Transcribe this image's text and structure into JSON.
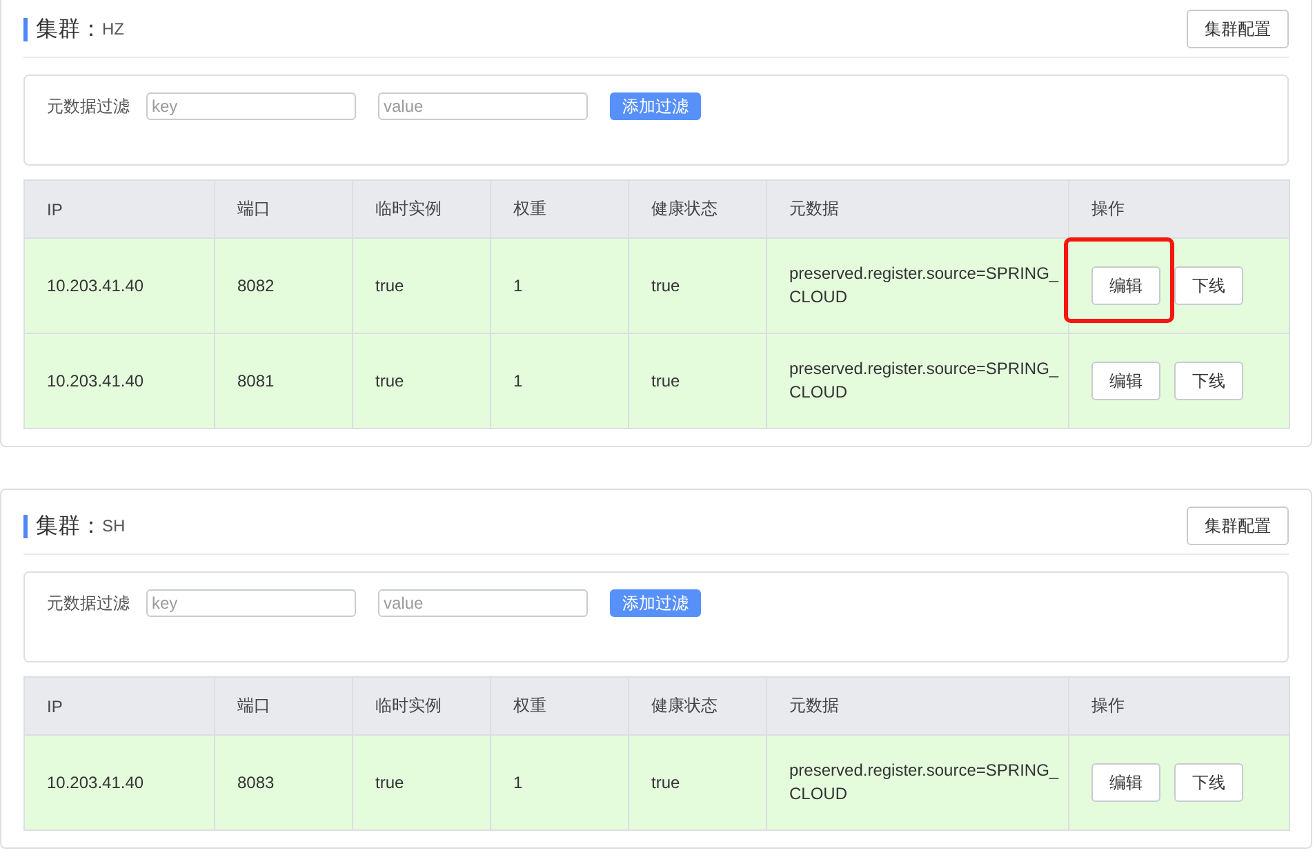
{
  "clusters": [
    {
      "cluster_label": "集群：",
      "name": "HZ",
      "config_button": "集群配置",
      "filter": {
        "label": "元数据过滤",
        "key_placeholder": "key",
        "value_placeholder": "value",
        "add_button": "添加过滤"
      },
      "columns": [
        "IP",
        "端口",
        "临时实例",
        "权重",
        "健康状态",
        "元数据",
        "操作"
      ],
      "rows": [
        {
          "ip": "10.203.41.40",
          "port": "8082",
          "ephemeral": "true",
          "weight": "1",
          "healthy": "true",
          "metadata": "preserved.register.source=SPRING_CLOUD",
          "edit": "编辑",
          "offline": "下线",
          "highlighted": true
        },
        {
          "ip": "10.203.41.40",
          "port": "8081",
          "ephemeral": "true",
          "weight": "1",
          "healthy": "true",
          "metadata": "preserved.register.source=SPRING_CLOUD",
          "edit": "编辑",
          "offline": "下线",
          "highlighted": false
        }
      ]
    },
    {
      "cluster_label": "集群：",
      "name": "SH",
      "config_button": "集群配置",
      "filter": {
        "label": "元数据过滤",
        "key_placeholder": "key",
        "value_placeholder": "value",
        "add_button": "添加过滤"
      },
      "columns": [
        "IP",
        "端口",
        "临时实例",
        "权重",
        "健康状态",
        "元数据",
        "操作"
      ],
      "rows": [
        {
          "ip": "10.203.41.40",
          "port": "8083",
          "ephemeral": "true",
          "weight": "1",
          "healthy": "true",
          "metadata": "preserved.register.source=SPRING_CLOUD",
          "edit": "编辑",
          "offline": "下线",
          "highlighted": false
        }
      ]
    }
  ]
}
